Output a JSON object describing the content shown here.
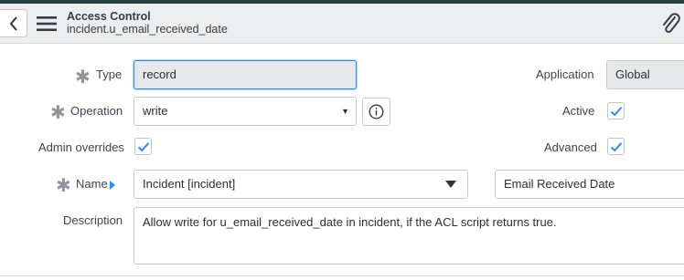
{
  "header": {
    "title": "Access Control",
    "subtitle": "incident.u_email_received_date"
  },
  "form": {
    "type": {
      "label": "Type",
      "value": "record"
    },
    "operation": {
      "label": "Operation",
      "value": "write"
    },
    "admin_overrides": {
      "label": "Admin overrides",
      "checked": true
    },
    "name": {
      "label": "Name",
      "table_value": "Incident [incident]",
      "field_value": "Email Received Date"
    },
    "description": {
      "label": "Description",
      "value": "Allow write for u_email_received_date in incident, if the ACL script returns true."
    },
    "application": {
      "label": "Application",
      "value": "Global"
    },
    "active": {
      "label": "Active",
      "checked": true
    },
    "advanced": {
      "label": "Advanced",
      "checked": true
    }
  },
  "icons": {
    "back": "chevron-left-icon",
    "menu": "hamburger-icon",
    "attach": "paperclip-icon",
    "info": "info-icon",
    "required": "asterisk-icon"
  },
  "colors": {
    "accent": "#278efc",
    "header_bg": "#eceef0",
    "top_strip": "#293e40"
  }
}
